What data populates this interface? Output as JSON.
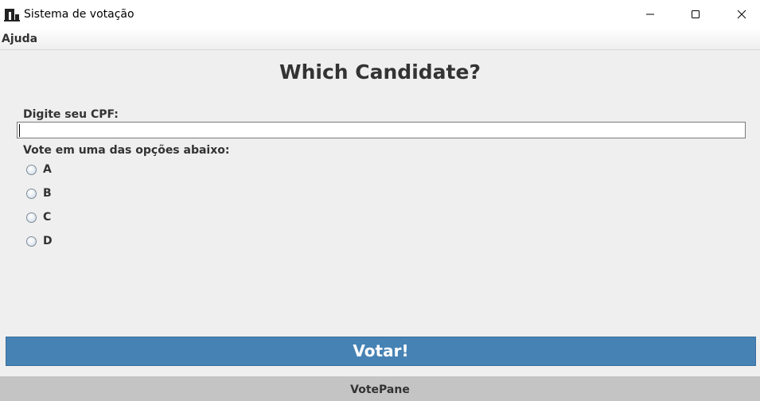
{
  "window": {
    "title": "Sistema de votação",
    "icon": "app-icon",
    "controls": [
      "minimize-icon",
      "maximize-icon",
      "close-icon"
    ]
  },
  "menubar": {
    "items": [
      {
        "label": "Ajuda"
      }
    ]
  },
  "main": {
    "heading": "Which Candidate?",
    "cpf_label": "Digite seu CPF:",
    "cpf_value": "",
    "vote_label": "Vote em uma das opções abaixo:",
    "options": [
      {
        "label": "A",
        "selected": false
      },
      {
        "label": "B",
        "selected": false
      },
      {
        "label": "C",
        "selected": false
      },
      {
        "label": "D",
        "selected": false
      }
    ],
    "submit_label": "Votar!",
    "submit_color": "#4682b4"
  },
  "footer": {
    "tab_label": "VotePane"
  }
}
